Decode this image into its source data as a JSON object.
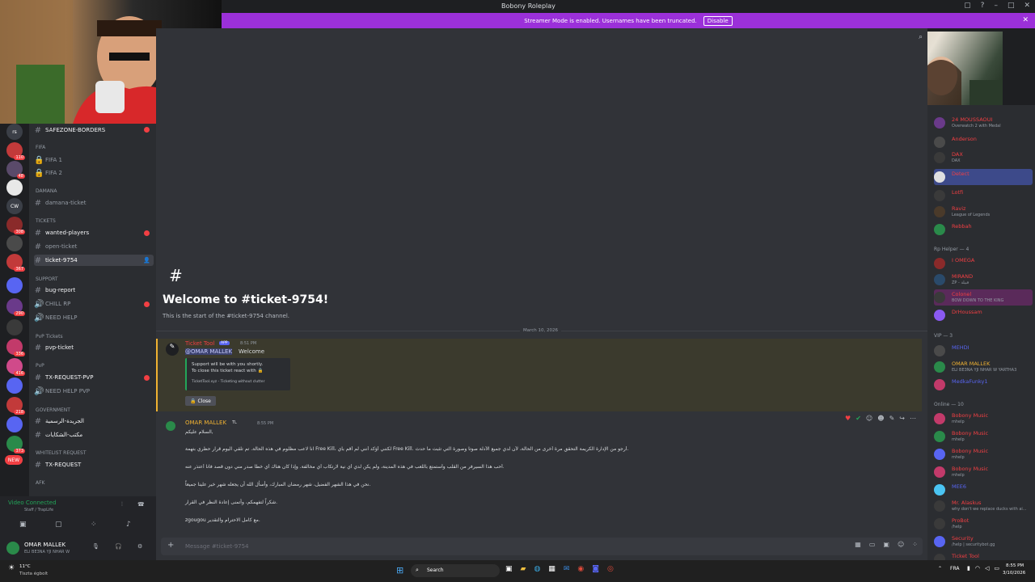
{
  "window": {
    "title": "Bobony Roleplay"
  },
  "banner": {
    "text": "Streamer Mode is enabled. Usernames have been truncated.",
    "button": "Disable"
  },
  "servers": [
    "rs",
    "",
    "",
    "",
    "CW",
    "",
    "",
    "",
    "",
    "",
    "",
    "",
    "",
    "",
    "",
    "",
    "",
    "",
    "",
    ""
  ],
  "server_badges": [
    "110",
    "48",
    "",
    "",
    "",
    "308",
    "",
    "",
    "367",
    "",
    "290",
    "",
    "336",
    "416",
    "",
    "218",
    "",
    "373",
    "NEW"
  ],
  "sidebar": {
    "top_channel": "SAFEZONE-BORDERS",
    "cat_fifa": "FIFA",
    "fifa1": "FIFA 1",
    "fifa2": "FIFA 2",
    "cat_damana": "DAMANA",
    "damana_ticket": "damana-ticket",
    "cat_tickets": "TICKETS",
    "wanted": "wanted-players",
    "open_ticket": "open-ticket",
    "ticket": "ticket-9754",
    "cat_support": "SUPPORT",
    "bug_report": "bug-report",
    "chill_rp": "CHILL RP",
    "need_help": "NEED HELP",
    "cat_pvp": "PvP Tickets",
    "pvp_ticket": "pvp-ticket",
    "cat_pvp2": "PvP",
    "tx_pvp": "TX-REQUEST-PVP",
    "need_help_pvp": "NEED HELP PVP",
    "cat_gov": "GOVERNMENT",
    "gov1": "الجريدة-الرسمية",
    "gov2": "مكتب-الشكايات",
    "cat_wl": "WHITELIST REQUEST",
    "tx_req": "TX-REQUEST",
    "cat_afk": "AFK"
  },
  "voice": {
    "status": "Video Connected",
    "sub": "Staff / TrapLife"
  },
  "user": {
    "name": "OMAR MALLEK",
    "sub": "ELI BE3NA YJI NHAR W"
  },
  "chat": {
    "hash": "#",
    "welcome_title": "Welcome to #ticket-9754!",
    "welcome_sub": "This is the start of the #ticket-9754 channel.",
    "date": "March 10, 2026",
    "bot_name": "Ticket Tool",
    "bot_tag": "APP",
    "bot_time": "8:51 PM",
    "mention": "@OMAR MALLEK",
    "welcome_word": "Welcome",
    "embed_line1": "Support will be with you shortly.",
    "embed_line2": "To close this ticket react with 🔒",
    "embed_footer": "TicketTool.xyz - Ticketing without clutter",
    "close_btn": "Close",
    "user_name": "OMAR MALLEK",
    "user_time": "8:55 PM",
    "user_role": "TL",
    "line1": "السلام عليكم,",
    "line2": "انا لاعب مظلوم في هذه الحالة. تم تلقي اليوم قرار حظري بتهمة Free Kill، لكنني أؤكد أنني لم أقم بأي Free Kill. أرجو من الإدارة الكريمة التحقق مرة أخرى من الحالة، لأن لدي جميع الأدلة صوتاً وصورة التي تثبت ما حدث.",
    "line3": "أحب هذا السيرفر من القلب وأستمتع باللعب في هذه المدينة، ولم يكن لدي أي نية لارتكاب أي مخالفة. وإذا كان هناك أي خطأ صدر مني دون قصد فأنا أعتذر عنه.",
    "line4": "نحن في هذا الشهر الفضيل، شهر رمضان المبارك، وأسأل الله أن يجعله شهر خير علينا جميعاً.",
    "line5": "شكراً لتفهمكم، وأتمنى إعادة النظر في القرار.",
    "line6": "zgougou",
    "line7": "مع كامل الاحترام والتقدير.",
    "input_placeholder": "Message #ticket-9754"
  },
  "members": {
    "list": [
      {
        "name": "24 MOUSSAOUI",
        "sub": "Overwatch 2 with Medal",
        "color": "#f23f43"
      },
      {
        "name": "Anderson",
        "sub": "",
        "color": "#f23f43"
      },
      {
        "name": "DAX",
        "sub": "DAX",
        "color": "#f23f43"
      },
      {
        "name": "Detect",
        "sub": "",
        "color": "#f23f43"
      },
      {
        "name": "Lotfi",
        "sub": "",
        "color": "#f23f43"
      },
      {
        "name": "Raviz",
        "sub": "League of Legends",
        "color": "#f23f43"
      },
      {
        "name": "Rebbah",
        "sub": "",
        "color": "#f23f43"
      }
    ],
    "group_rp": "Rp Helper — 4",
    "rp": [
      {
        "name": "I OMEGA",
        "sub": "",
        "color": "#f23f43"
      },
      {
        "name": "MIRAND",
        "sub": "ZP - قبيلة",
        "color": "#f23f43"
      },
      {
        "name": "Colonel",
        "sub": "BOW DOWN TO THE KING",
        "color": "#f23f43"
      },
      {
        "name": "DrHoussam",
        "sub": "",
        "color": "#f23f43"
      }
    ],
    "group_vip": "VIP — 3",
    "vip": [
      {
        "name": "MEHDI",
        "sub": "",
        "color": "#5865f2"
      },
      {
        "name": "OMAR MALLEK",
        "sub": "ELI BE3NA YJI NHAR W YARTHA3",
        "color": "#f0b232"
      },
      {
        "name": "MedkaFunky1",
        "sub": "",
        "color": "#5865f2"
      }
    ],
    "group_online": "Online — 10",
    "online": [
      {
        "name": "Bobony Music",
        "sub": "mhelp",
        "color": "#5865f2"
      },
      {
        "name": "Bobony Music",
        "sub": "mhelp",
        "color": "#5865f2"
      },
      {
        "name": "Bobony Music",
        "sub": "mhelp",
        "color": "#5865f2"
      },
      {
        "name": "Bobony Music",
        "sub": "mhelp",
        "color": "#5865f2"
      },
      {
        "name": "MEE6",
        "sub": "",
        "color": "#5865f2"
      },
      {
        "name": "Mr. Alaskus",
        "sub": "why don't we replace ducks with ai...",
        "color": "#f23f43"
      },
      {
        "name": "ProBot",
        "sub": "/help",
        "color": "#f23f43"
      },
      {
        "name": "Security",
        "sub": "/help | securitybot.gg",
        "color": "#f23f43"
      },
      {
        "name": "Ticket Tool",
        "sub": "",
        "color": "#f23f43"
      }
    ],
    "app_tag": "APP"
  },
  "taskbar": {
    "weather_temp": "11°C",
    "weather_desc": "Tiszta égbolt",
    "search": "Search",
    "lang": "FRA",
    "time": "8:55 PM",
    "date": "3/10/2026"
  }
}
